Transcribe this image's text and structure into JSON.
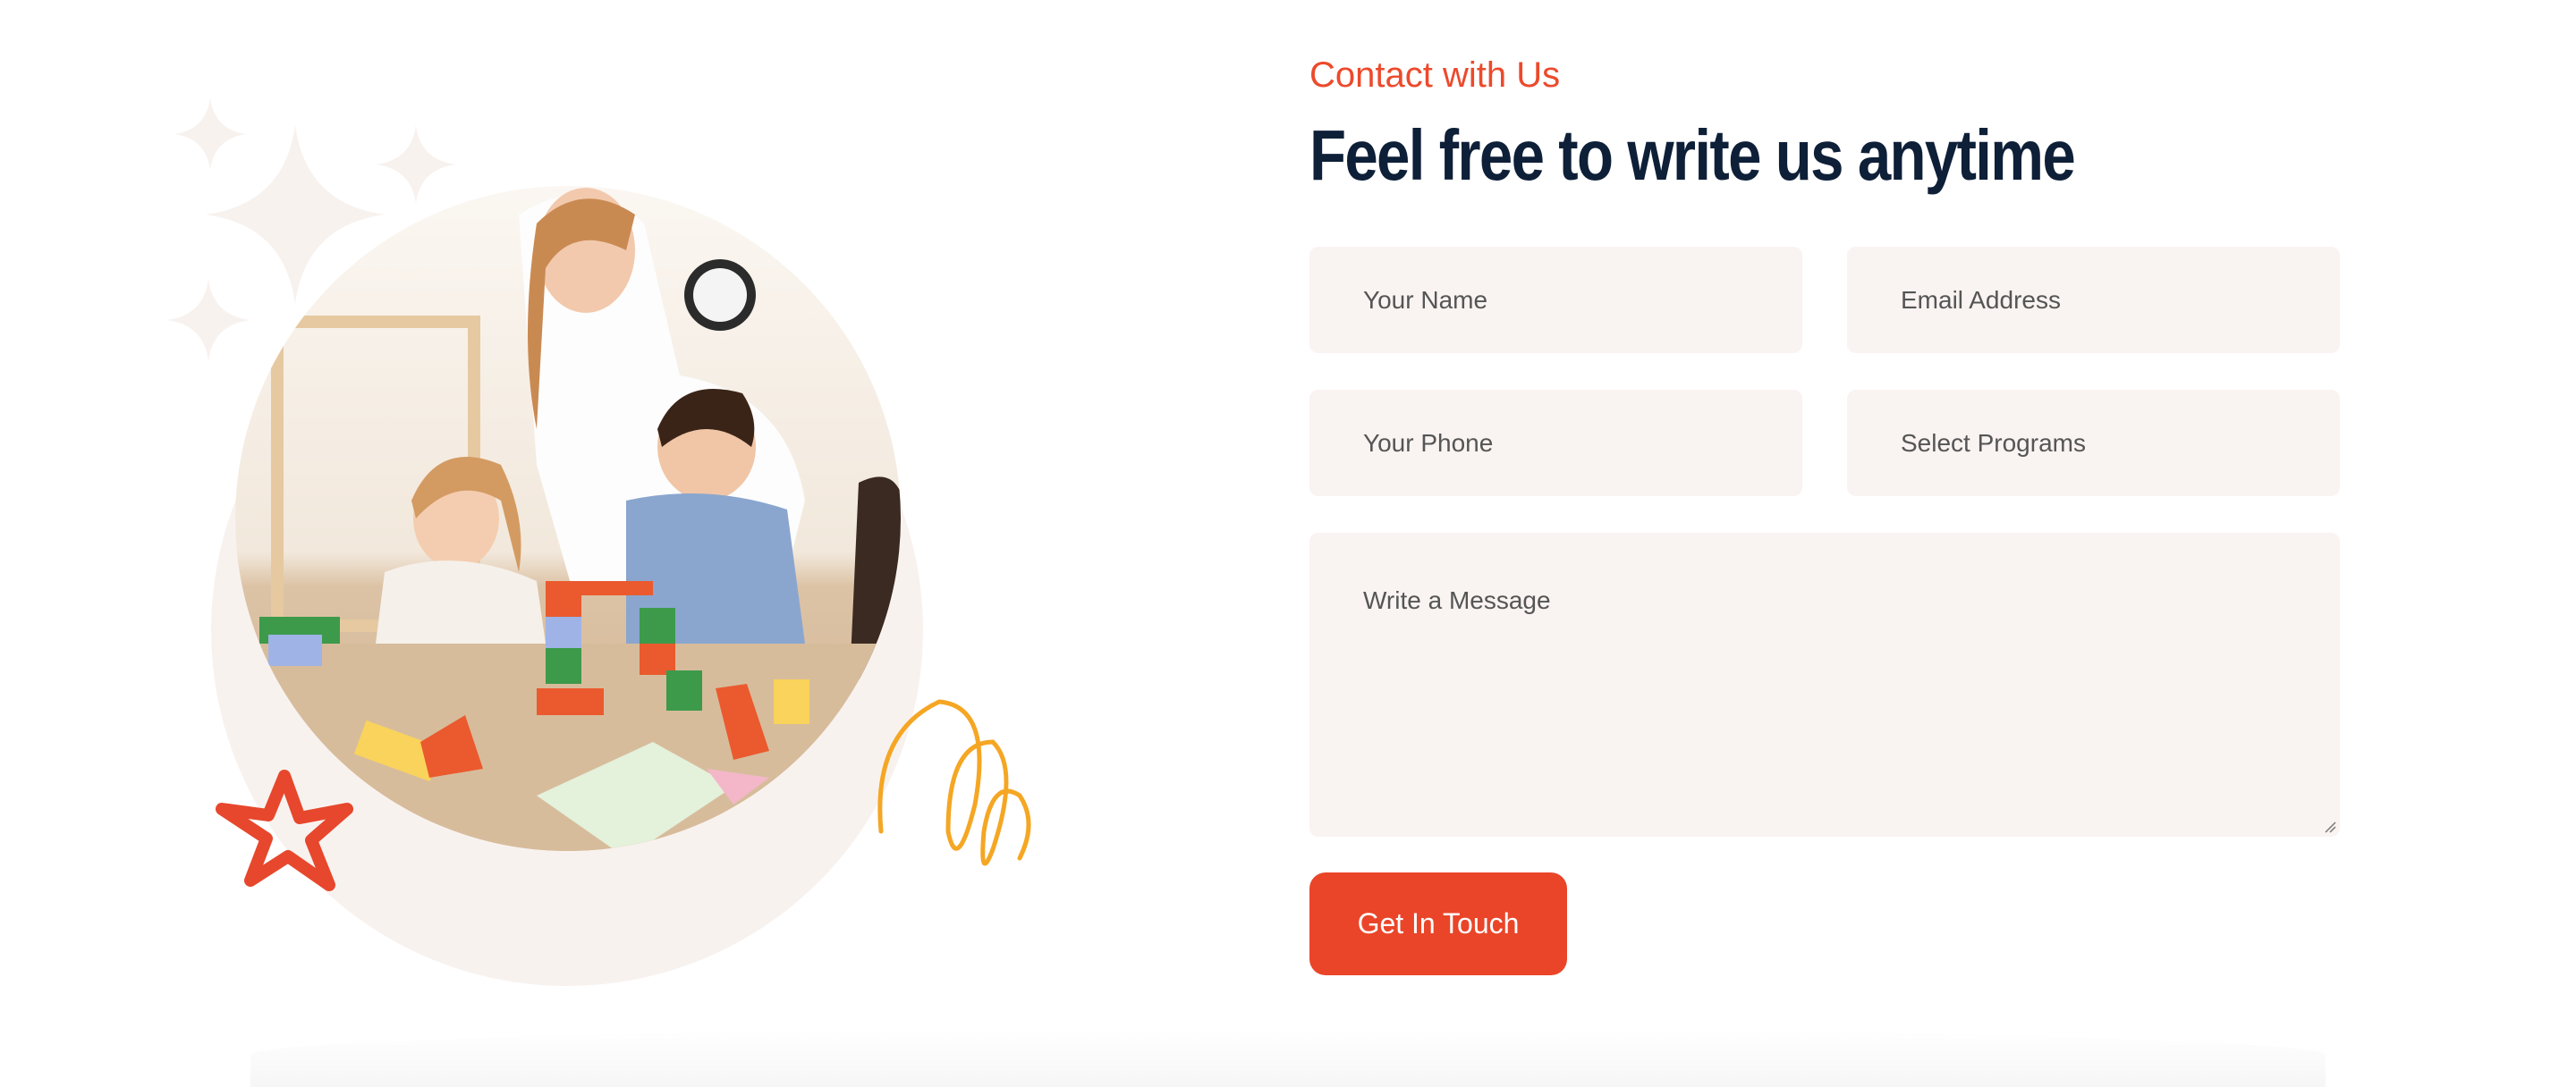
{
  "section": {
    "eyebrow": "Contact with Us",
    "title": "Feel free to write us anytime"
  },
  "form": {
    "name_placeholder": "Your Name",
    "email_placeholder": "Email Address",
    "phone_placeholder": "Your Phone",
    "program_placeholder": "Select Programs",
    "message_placeholder": "Write a Message",
    "submit_label": "Get In Touch"
  },
  "colors": {
    "accent": "#ea4529",
    "heading": "#0e1f38",
    "field_bg": "#f9f3f1",
    "scribble": "#f5a623"
  }
}
